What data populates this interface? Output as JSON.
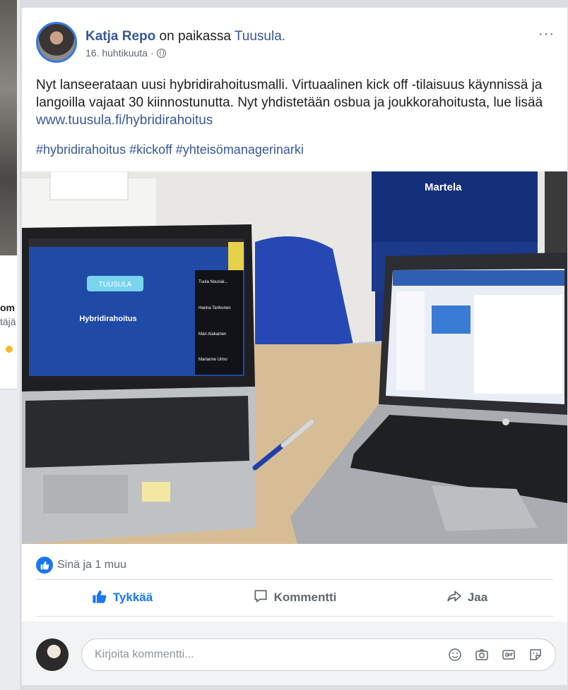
{
  "background_card": {
    "fragment_bold": "om",
    "fragment_light": "täjä"
  },
  "post": {
    "author": "Katja Repo",
    "place_prefix": " on paikassa ",
    "place": "Tuusula.",
    "date": "16. huhtikuuta",
    "meta_separator": "·",
    "more_label": "···",
    "text_before_link": "Nyt lanseerataan uusi hybridirahoitusmalli. Virtuaalinen kick off -tilaisuus käynnissä ja langoilla vajaat 30 kiinnostunutta. Nyt yhdistetään osbua ja joukkorahoitusta, lue lisää ",
    "link": "www.tuusula.fi/hybridirahoitus",
    "hashtags": "#hybridirahoitus #kickoff #yhteisömanagerinarki"
  },
  "photo": {
    "box_brand": "Martela",
    "left_screen_logo": "TUUSULA",
    "left_screen_title": "Hybridirahoitus",
    "participants": [
      "Tuula Nousiai...",
      "Hanna Tanhunen",
      "Mari Alakainen",
      "Marianne Uimo"
    ]
  },
  "reactions": {
    "text": "Sinä ja 1 muu"
  },
  "actions": {
    "like": "Tykkää",
    "comment": "Kommentti",
    "share": "Jaa"
  },
  "comment_box": {
    "placeholder": "Kirjoita kommentti..."
  },
  "icons": {
    "like": "thumbs-up-icon",
    "comment": "speech-bubble-icon",
    "share": "share-arrow-icon",
    "emoji": "smiley-icon",
    "camera": "camera-icon",
    "gif": "gif-icon",
    "sticker": "sticker-icon",
    "privacy": "globe-icon"
  },
  "colors": {
    "brand_blue": "#1877f2",
    "link_blue": "#385898",
    "avatar_ring": "#3578e5"
  }
}
